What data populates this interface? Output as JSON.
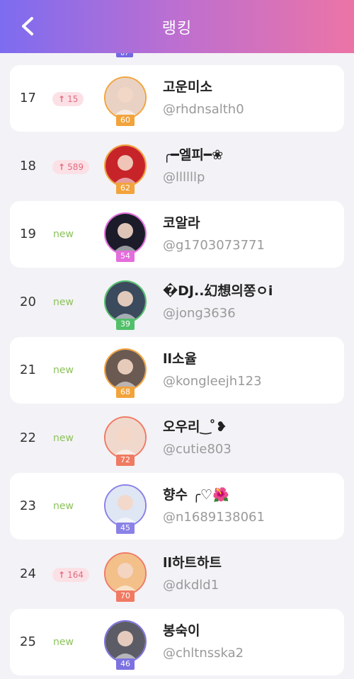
{
  "header": {
    "title": "랭킹"
  },
  "peek_level": "87",
  "rows": [
    {
      "rank": "17",
      "change": "15",
      "is_new": false,
      "name": "고운미소",
      "handle": "@rhdnsalth0",
      "level": "60",
      "color": "#f2a33c",
      "card": true,
      "icon": "avatar-photo"
    },
    {
      "rank": "18",
      "change": "589",
      "is_new": false,
      "name": "╭━엘피━❀",
      "handle": "@llllllp",
      "level": "62",
      "color": "#f2a33c",
      "card": false,
      "icon": "avatar-photo"
    },
    {
      "rank": "19",
      "change": "new",
      "is_new": true,
      "name": "코알라",
      "handle": "@g1703073771",
      "level": "54",
      "color": "#e46ddc",
      "card": true,
      "icon": "avatar-photo"
    },
    {
      "rank": "20",
      "change": "new",
      "is_new": true,
      "name": "�DJ..幻想의쫑ㅇi",
      "handle": "@jong3636",
      "level": "39",
      "color": "#52c06a",
      "card": false,
      "icon": "avatar-photo"
    },
    {
      "rank": "21",
      "change": "new",
      "is_new": true,
      "name": "ll소율",
      "handle": "@kongleejh123",
      "level": "68",
      "color": "#f2a33c",
      "card": true,
      "icon": "avatar-photo"
    },
    {
      "rank": "22",
      "change": "new",
      "is_new": true,
      "name": "오우리‿ ̊❥",
      "handle": "@cutie803",
      "level": "72",
      "color": "#f07a62",
      "card": false,
      "icon": "avatar-photo"
    },
    {
      "rank": "23",
      "change": "new",
      "is_new": true,
      "name": "향수 ╭♡🌺",
      "handle": "@n1689138061",
      "level": "45",
      "color": "#8a82e6",
      "card": true,
      "icon": "avatar-photo"
    },
    {
      "rank": "24",
      "change": "164",
      "is_new": false,
      "name": "ll하트하트",
      "handle": "@dkdld1",
      "level": "70",
      "color": "#f07a62",
      "card": false,
      "icon": "avatar-photo"
    },
    {
      "rank": "25",
      "change": "new",
      "is_new": true,
      "name": "봉숙이",
      "handle": "@chltnsska2",
      "level": "46",
      "color": "#7d72e0",
      "card": true,
      "icon": "avatar-photo"
    }
  ]
}
